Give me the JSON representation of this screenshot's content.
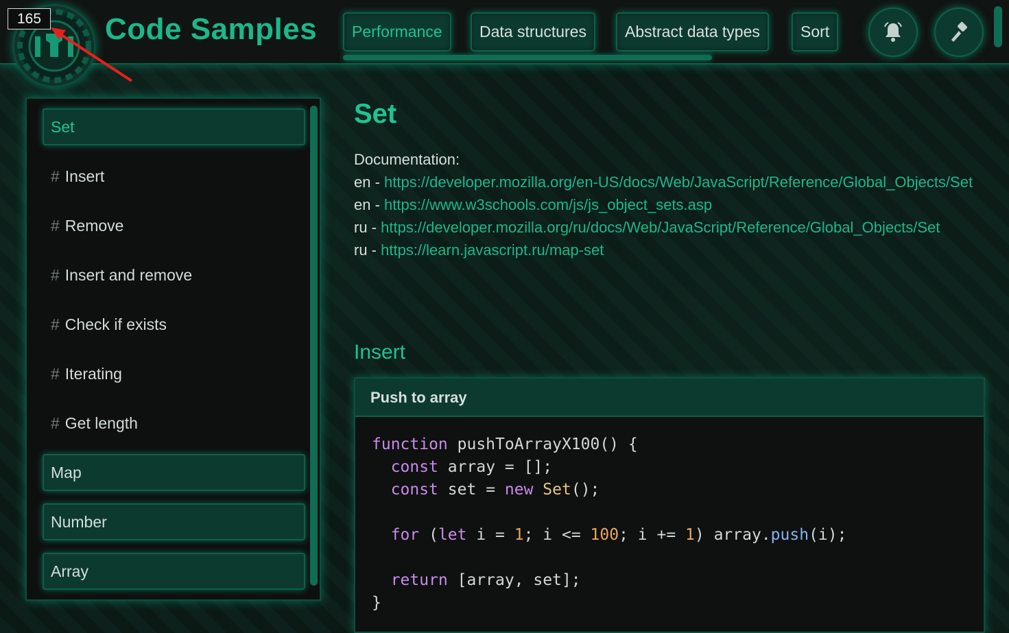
{
  "header": {
    "counter": "165",
    "title": "Code Samples",
    "nav": [
      "Performance",
      "Data structures",
      "Abstract data types",
      "Sort"
    ],
    "active_nav": "Performance",
    "icons": [
      "bell-icon",
      "brush-icon"
    ]
  },
  "sidebar": {
    "groups": [
      "Set",
      "Map",
      "Number",
      "Array"
    ],
    "active_group": "Set",
    "set_items": [
      "Insert",
      "Remove",
      "Insert and remove",
      "Check if exists",
      "Iterating",
      "Get length"
    ],
    "hash": "#"
  },
  "main": {
    "title": "Set",
    "doc_label": "Documentation:",
    "links": [
      {
        "lang": "en",
        "url": "https://developer.mozilla.org/en-US/docs/Web/JavaScript/Reference/Global_Objects/Set"
      },
      {
        "lang": "en",
        "url": "https://www.w3schools.com/js/js_object_sets.asp"
      },
      {
        "lang": "ru",
        "url": "https://developer.mozilla.org/ru/docs/Web/JavaScript/Reference/Global_Objects/Set"
      },
      {
        "lang": "ru",
        "url": "https://learn.javascript.ru/map-set"
      }
    ],
    "section": "Insert",
    "code_title": "Push to array",
    "code_lines": [
      "function pushToArrayX100() {",
      "  const array = [];",
      "  const set = new Set();",
      "",
      "  for (let i = 1; i <= 100; i += 1) array.push(i);",
      "",
      "  return [array, set];",
      "}"
    ]
  },
  "colors": {
    "accent": "#1cc592",
    "panel": "#0d3a2f",
    "border": "#0f5f49",
    "arrow": "#e8201c"
  }
}
